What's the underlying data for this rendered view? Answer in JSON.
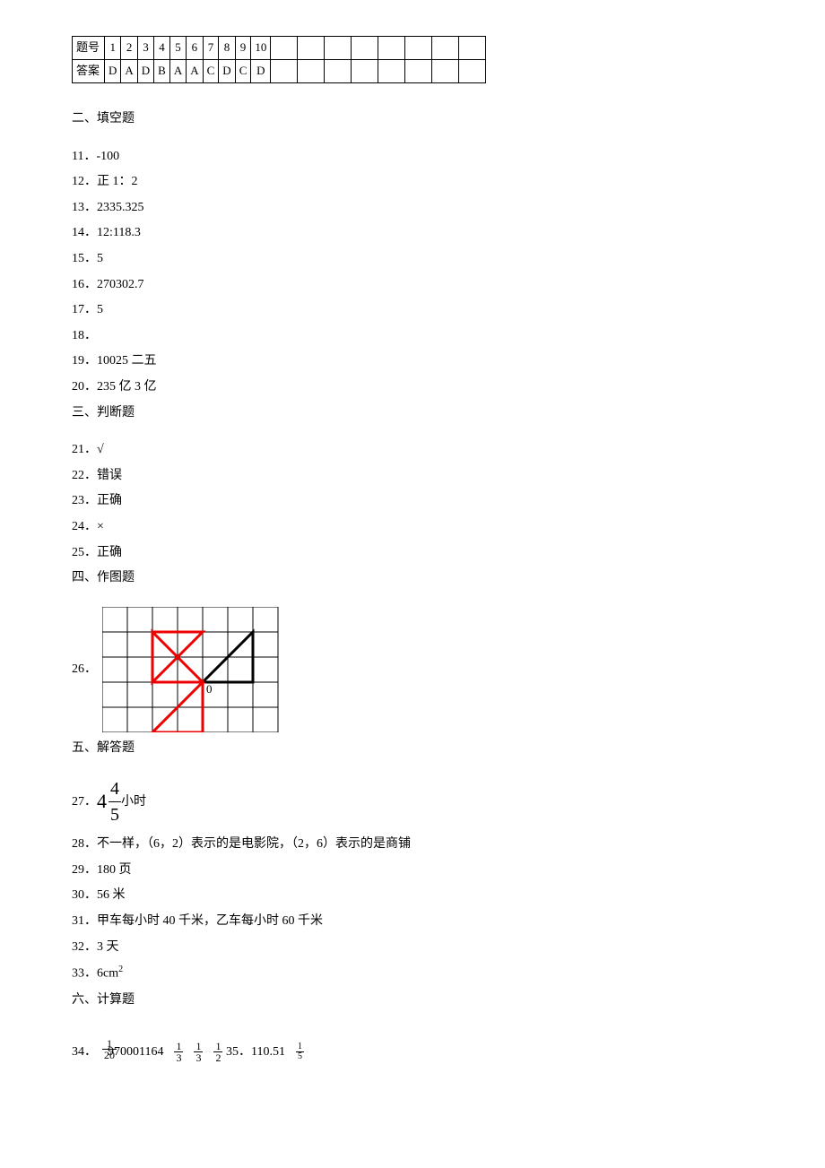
{
  "table": {
    "row1_label": "题号",
    "row2_label": "答案",
    "questions": [
      "1",
      "2",
      "3",
      "4",
      "5",
      "6",
      "7",
      "8",
      "9",
      "10"
    ],
    "answers": [
      "D",
      "A",
      "D",
      "B",
      "A",
      "A",
      "C",
      "D",
      "C",
      "D"
    ]
  },
  "sections": {
    "fill": "二、填空题",
    "judge": "三、判断题",
    "draw": "四、作图题",
    "solve": "五、解答题",
    "calc": "六、计算题"
  },
  "fill": {
    "q11": "11．-100",
    "q12": "12．正 1：2",
    "q13": "13．2335.325",
    "q14": "14．12:118.3",
    "q15": "15．5",
    "q16": "16．270302.7",
    "q17": "17．5",
    "q18": "18．",
    "q19": "19．10025 二五",
    "q20": "20．235 亿 3 亿"
  },
  "judge": {
    "q21": "21．√",
    "q22": "22．错误",
    "q23": "23．正确",
    "q24": "24．×",
    "q25": "25．正确"
  },
  "draw": {
    "q26": "26．",
    "origin": "0"
  },
  "solve": {
    "q27_prefix": "27．",
    "q27_whole": "4",
    "q27_num": "4",
    "q27_den": "5",
    "q27_suffix": "小时",
    "q28": "28．不一样，（6，2）表示的是电影院，（2，6）表示的是商铺",
    "q29": "29．180 页",
    "q30": "30．56 米",
    "q31": "31．甲车每小时 40 千米，乙车每小时 60 千米",
    "q32": "32．3 天",
    "q33_prefix": "33．6cm",
    "q33_sup": "2"
  },
  "calc": {
    "q34_prefix": "34．",
    "q34_f1_num": "1",
    "q34_f1_den": "20",
    "q34_mid": "970001164",
    "q34_f2_num": "1",
    "q34_f2_den": "3",
    "q34_f3_num": "1",
    "q34_f3_den": "3",
    "q34_f4_num": "1",
    "q34_f4_den": "2",
    "q35_prefix": "35．110.51",
    "q35_f_num": "1",
    "q35_f_den": "5"
  }
}
